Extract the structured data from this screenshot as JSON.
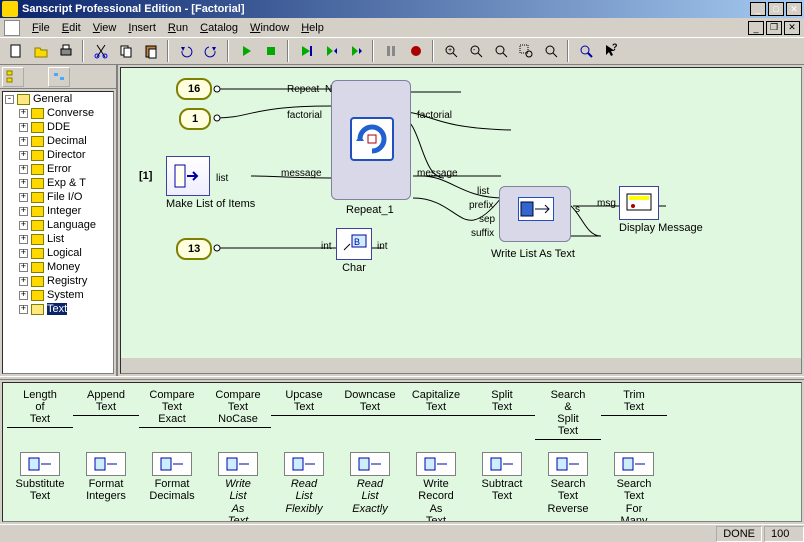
{
  "title": "Sanscript Professional Edition - [Factorial]",
  "menus": [
    "File",
    "Edit",
    "View",
    "Insert",
    "Run",
    "Catalog",
    "Window",
    "Help"
  ],
  "tree": {
    "root": "General",
    "items": [
      "Converse",
      "DDE",
      "Decimal",
      "Director",
      "Error",
      "Exp & T",
      "File I/O",
      "Integer",
      "Language",
      "List",
      "Logical",
      "Money",
      "Registry",
      "System",
      "Text"
    ],
    "selected": "Text"
  },
  "canvas": {
    "val16": "16",
    "val1": "1",
    "val_bracket": "[1]",
    "val13": "13",
    "make_list": "Make List of Items",
    "repeat": "Repeat_1",
    "char": "Char",
    "writelist": "Write List As Text",
    "display": "Display Message",
    "p_repeat": "Repeat",
    "p_N": "N",
    "p_factorial_in": "factorial",
    "p_factorial_out": "factorial",
    "p_message_in": "message",
    "p_message_out": "message",
    "p_list": "list",
    "p_int_in": "int",
    "p_int_out": "int",
    "p_prefix": "prefix",
    "p_sep": "sep",
    "p_suffix": "suffix",
    "p_s": "s",
    "p_msg": "msg"
  },
  "palette_top": [
    "Length of Text",
    "Append Text",
    "Compare Text Exact",
    "Compare Text NoCase",
    "Upcase Text",
    "Downcase Text",
    "Capitalize Text",
    "Split Text",
    "Search & Split Text",
    "Trim Text"
  ],
  "palette_bottom": [
    {
      "label": "Substitute Text",
      "it": false
    },
    {
      "label": "Format Integers",
      "it": false
    },
    {
      "label": "Format Decimals",
      "it": false
    },
    {
      "label": "Write List As Text",
      "it": true
    },
    {
      "label": "Read List Flexibly",
      "it": true
    },
    {
      "label": "Read List Exactly",
      "it": true
    },
    {
      "label": "Write Record As Text",
      "it": false
    },
    {
      "label": "Subtract Text",
      "it": false
    },
    {
      "label": "Search Text Reverse",
      "it": false
    },
    {
      "label": "Search Text For Many",
      "it": false
    }
  ],
  "status": {
    "done": "DONE",
    "pct": "100"
  }
}
